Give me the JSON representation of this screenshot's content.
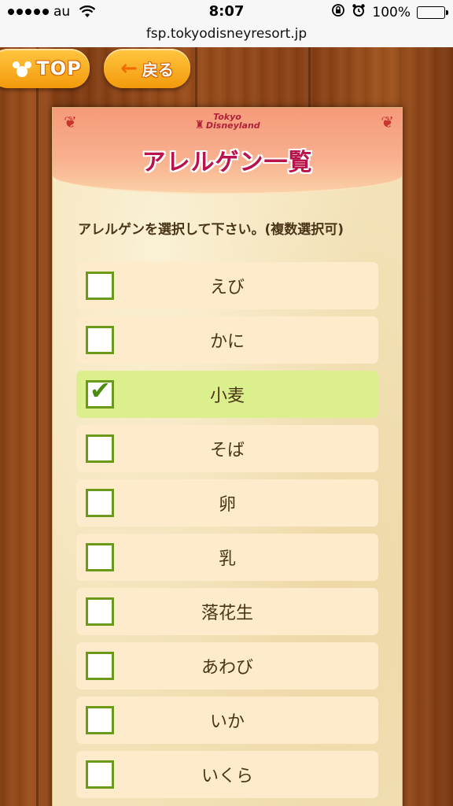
{
  "status_bar": {
    "carrier": "au",
    "time": "8:07",
    "battery": "100%"
  },
  "url": "fsp.tokyodisneyresort.jp",
  "nav": {
    "top_label": "TOP",
    "back_label": "戻る"
  },
  "header": {
    "logo_line1": "Tokyo",
    "logo_line2": "Disneyland",
    "title": "アレルゲン一覧"
  },
  "instruction": "アレルゲンを選択して下さい。(複数選択可)",
  "allergens": [
    {
      "label": "えび",
      "checked": false
    },
    {
      "label": "かに",
      "checked": false
    },
    {
      "label": "小麦",
      "checked": true
    },
    {
      "label": "そば",
      "checked": false
    },
    {
      "label": "卵",
      "checked": false
    },
    {
      "label": "乳",
      "checked": false
    },
    {
      "label": "落花生",
      "checked": false
    },
    {
      "label": "あわび",
      "checked": false
    },
    {
      "label": "いか",
      "checked": false
    },
    {
      "label": "いくら",
      "checked": false
    }
  ],
  "colors": {
    "title": "#b8134a",
    "checked_row": "#dbf08c",
    "row": "#fdebcb",
    "checkbox_border": "#6b9a1a",
    "nav_button": "#f7a51a"
  },
  "icons": {
    "signal": "signal-dots-icon",
    "wifi": "wifi-icon",
    "lock_rotation": "orientation-lock-icon",
    "alarm": "alarm-icon",
    "battery": "battery-icon",
    "mickey": "mickey-icon",
    "back_arrow": "arrow-left-icon",
    "check": "checkmark-icon"
  }
}
